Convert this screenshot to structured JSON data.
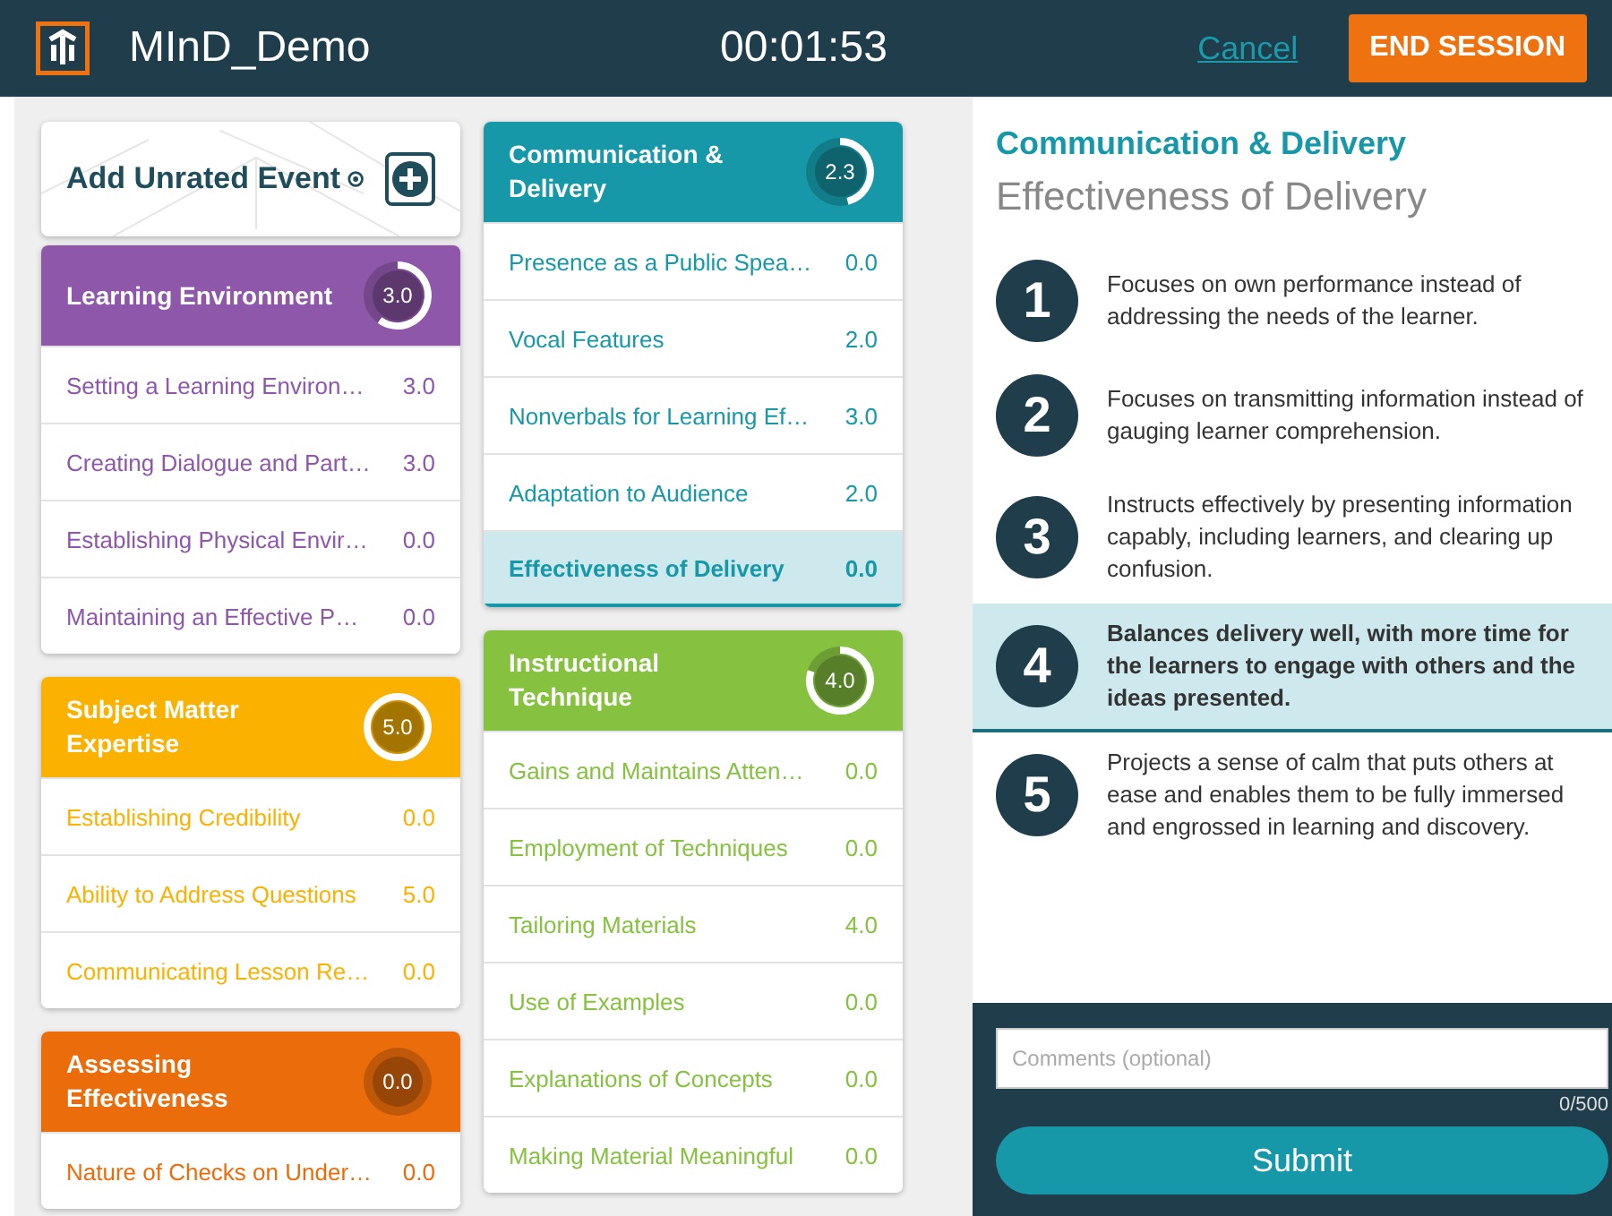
{
  "header": {
    "title": "MInD_Demo",
    "timer": "00:01:53",
    "cancel": "Cancel",
    "end_button": "END SESSION"
  },
  "add_event": {
    "label": "Add Unrated Event"
  },
  "columns": [
    {
      "categories": [
        {
          "title": "Learning Environment",
          "score": "3.0",
          "level": 0.6,
          "color": "#8e57aa",
          "items": [
            {
              "label": "Setting a Learning Environ…",
              "score": "3.0",
              "selected": false
            },
            {
              "label": "Creating Dialogue and Part…",
              "score": "3.0",
              "selected": false
            },
            {
              "label": "Establishing Physical Envir…",
              "score": "0.0",
              "selected": false
            },
            {
              "label": "Maintaining an Effective P…",
              "score": "0.0",
              "selected": false
            }
          ]
        },
        {
          "title": "Subject Matter Expertise",
          "score": "5.0",
          "level": 1,
          "color": "#fbb100",
          "items": [
            {
              "label": "Establishing Credibility",
              "score": "0.0",
              "selected": false
            },
            {
              "label": "Ability to Address Questions",
              "score": "5.0",
              "selected": false
            },
            {
              "label": "Communicating Lesson Re…",
              "score": "0.0",
              "selected": false
            }
          ]
        },
        {
          "title": "Assessing Effectiveness",
          "score": "0.0",
          "color": "#ea6c0b",
          "items": [
            {
              "label": "Nature of Checks on Under…",
              "score": "0.0",
              "selected": false
            }
          ]
        }
      ]
    },
    {
      "categories": [
        {
          "title": "Communication & Delivery",
          "score": "2.3",
          "level": 0.46,
          "color": "#1798a8",
          "items": [
            {
              "label": "Presence as a Public Spea…",
              "score": "0.0",
              "selected": false
            },
            {
              "label": "Vocal Features",
              "score": "2.0",
              "selected": false
            },
            {
              "label": "Nonverbals for Learning Ef…",
              "score": "3.0",
              "selected": false
            },
            {
              "label": "Adaptation to Audience",
              "score": "2.0",
              "selected": false
            },
            {
              "label": "Effectiveness of Delivery",
              "score": "0.0",
              "selected": true
            }
          ]
        },
        {
          "title": "Instructional Technique",
          "score": "4.0",
          "level": 0.8,
          "color": "#86c140",
          "items": [
            {
              "label": "Gains and Maintains Atten…",
              "score": "0.0",
              "selected": false
            },
            {
              "label": "Employment of Techniques",
              "score": "0.0",
              "selected": false
            },
            {
              "label": "Tailoring Materials",
              "score": "4.0",
              "selected": false
            },
            {
              "label": "Use of Examples",
              "score": "0.0",
              "selected": false
            },
            {
              "label": "Explanations of Concepts",
              "score": "0.0",
              "selected": false
            },
            {
              "label": "Making Material Meaningful",
              "score": "0.0",
              "selected": false
            }
          ]
        }
      ]
    }
  ],
  "detail": {
    "category": "Communication & Delivery",
    "subtitle": "Effectiveness of Delivery",
    "levels": [
      {
        "number": "1",
        "text": "Focuses on own performance instead of addressing the needs of the learner.",
        "selected": false
      },
      {
        "number": "2",
        "text": "Focuses on transmitting information instead of gauging learner comprehension.",
        "selected": false
      },
      {
        "number": "3",
        "text": "Instructs effectively by presenting information capably, including learners, and clearing up confusion.",
        "selected": false
      },
      {
        "number": "4",
        "text": "Balances delivery well, with more time for the learners to engage with others and the ideas presented.",
        "selected": true
      },
      {
        "number": "5",
        "text": "Projects a sense of calm that puts others at ease and enables them to be fully immersed and engrossed in learning and discovery.",
        "selected": false
      }
    ],
    "comments": {
      "placeholder": "Comments (optional)",
      "counter": "0/500"
    },
    "submit": "Submit"
  }
}
